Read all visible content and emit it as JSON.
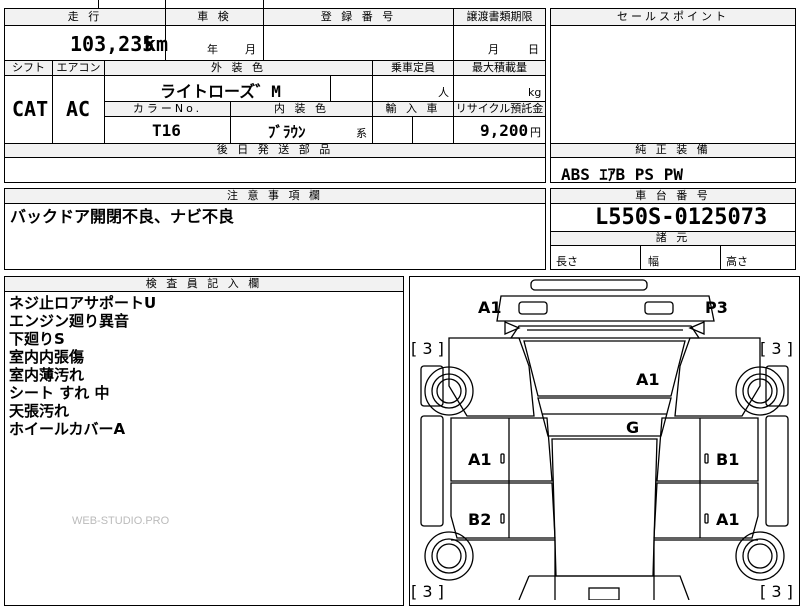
{
  "headers": {
    "mileage": "走 行",
    "shaken": "車 検",
    "reg_no": "登 録 番 号",
    "transfer_deadline": "譲渡書類期限",
    "sales_point": "セールスポイント",
    "shift": "シフト",
    "aircon": "エアコン",
    "ext_color": "外 装 色",
    "capacity": "乗車定員",
    "max_load": "最大積載量",
    "color_no": "カラーNo.",
    "int_color": "内 装 色",
    "import": "輸 入 車",
    "recycle": "リサイクル預託金",
    "later_parts": "後 日 発 送 部 品",
    "equipment": "純 正 装 備",
    "notes": "注 意 事 項 欄",
    "chassis": "車 台 番 号",
    "dimensions": "諸 元",
    "inspector": "検 査 員 記 入 欄"
  },
  "values": {
    "mileage": "103,235",
    "mileage_unit": "km",
    "shaken_year": "年",
    "shaken_month": "月",
    "deadline_month": "月",
    "deadline_day": "日",
    "shift": "CAT",
    "aircon": "AC",
    "ext_color": "ライトローズ゛M",
    "capacity_unit": "人",
    "load_unit": "kg",
    "color_no": "T16",
    "int_color": "ﾌﾞﾗｳﾝ",
    "int_color_suffix": "系",
    "recycle": "9,200",
    "recycle_unit": "円",
    "equipment": "ABS ｴｱB PS PW",
    "notes": "バックドア開閉不良、ナビ不良",
    "chassis": "L550S-0125073",
    "len_label": "長さ",
    "width_label": "幅",
    "height_label": "高さ"
  },
  "inspector_notes": [
    "ネジ止ロアサポートU",
    "エンジン廻り異音",
    "下廻りS",
    "室内内張傷",
    "室内薄汚れ",
    "シート すれ 中",
    "天張汚れ",
    "ホイールカバーA"
  ],
  "watermark": "WEB-STUDIO.PRO",
  "damage_marks": {
    "front_left": "A1",
    "front_right": "P3",
    "hood": "A1",
    "roof": "G",
    "front_door_left": "A1",
    "front_door_right": "B1",
    "rear_door_left": "B2",
    "rear_door_right": "A1",
    "tire_fl": "[ 3 ]",
    "tire_fr": "[ 3 ]",
    "tire_rl": "[ 3 ]",
    "tire_rr": "[ 3 ]"
  }
}
